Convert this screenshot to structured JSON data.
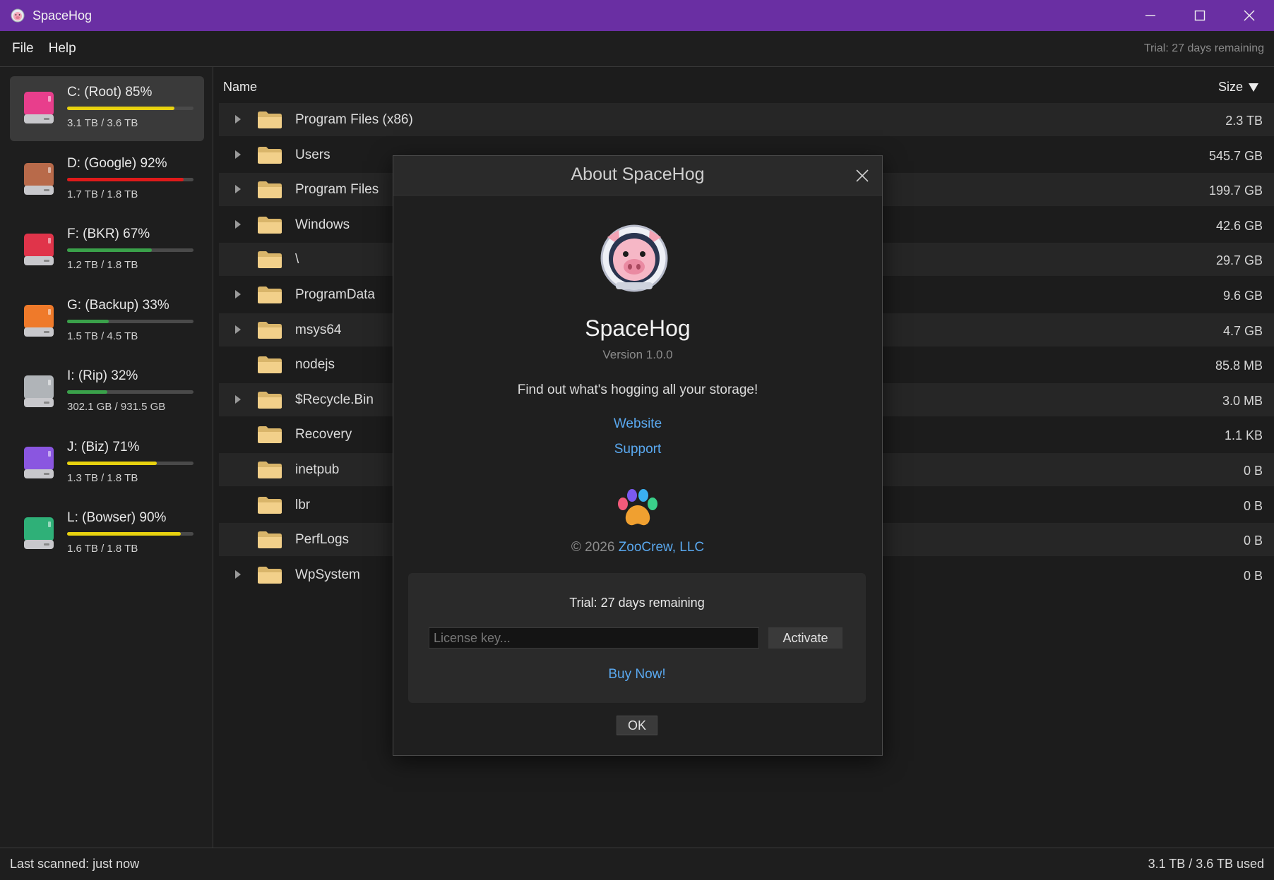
{
  "window": {
    "title": "SpaceHog"
  },
  "menu": {
    "file": "File",
    "help": "Help",
    "trial_status": "Trial: 27 days remaining"
  },
  "drives": [
    {
      "name": "C: (Root) 85%",
      "size": "3.1 TB / 3.6 TB",
      "usage": 0.85,
      "bar_color": "#e8d20f",
      "icon_color": "#e83e8c",
      "selected": true
    },
    {
      "name": "D: (Google) 92%",
      "size": "1.7 TB / 1.8 TB",
      "usage": 0.92,
      "bar_color": "#e01a1a",
      "icon_color": "#b86a4a",
      "selected": false
    },
    {
      "name": "F: (BKR) 67%",
      "size": "1.2 TB / 1.8 TB",
      "usage": 0.67,
      "bar_color": "#3aa14a",
      "icon_color": "#e0344a",
      "selected": false
    },
    {
      "name": "G: (Backup) 33%",
      "size": "1.5 TB / 4.5 TB",
      "usage": 0.33,
      "bar_color": "#3aa14a",
      "icon_color": "#ef7a2a",
      "selected": false
    },
    {
      "name": "I: (Rip) 32%",
      "size": "302.1 GB / 931.5 GB",
      "usage": 0.32,
      "bar_color": "#3aa14a",
      "icon_color": "#b0b4b8",
      "selected": false
    },
    {
      "name": "J: (Biz) 71%",
      "size": "1.3 TB / 1.8 TB",
      "usage": 0.71,
      "bar_color": "#e8d20f",
      "icon_color": "#8a56e0",
      "selected": false
    },
    {
      "name": "L: (Bowser) 90%",
      "size": "1.6 TB / 1.8 TB",
      "usage": 0.9,
      "bar_color": "#e8d20f",
      "icon_color": "#2fb078",
      "selected": false
    }
  ],
  "list": {
    "header_name": "Name",
    "header_size": "Size",
    "rows": [
      {
        "name": "Program Files (x86)",
        "size": "2.3 TB",
        "expandable": true
      },
      {
        "name": "Users",
        "size": "545.7 GB",
        "expandable": true
      },
      {
        "name": "Program Files",
        "size": "199.7 GB",
        "expandable": true
      },
      {
        "name": "Windows",
        "size": "42.6 GB",
        "expandable": true
      },
      {
        "name": "\\",
        "size": "29.7 GB",
        "expandable": false
      },
      {
        "name": "ProgramData",
        "size": "9.6 GB",
        "expandable": true
      },
      {
        "name": "msys64",
        "size": "4.7 GB",
        "expandable": true
      },
      {
        "name": "nodejs",
        "size": "85.8 MB",
        "expandable": false
      },
      {
        "name": "$Recycle.Bin",
        "size": "3.0 MB",
        "expandable": true
      },
      {
        "name": "Recovery",
        "size": "1.1 KB",
        "expandable": false
      },
      {
        "name": "inetpub",
        "size": "0 B",
        "expandable": false
      },
      {
        "name": "lbr",
        "size": "0 B",
        "expandable": false
      },
      {
        "name": "PerfLogs",
        "size": "0 B",
        "expandable": false
      },
      {
        "name": "WpSystem",
        "size": "0 B",
        "expandable": true
      }
    ]
  },
  "status": {
    "left": "Last scanned: just now",
    "right": "3.1 TB / 3.6 TB used"
  },
  "about": {
    "title": "About SpaceHog",
    "app_name": "SpaceHog",
    "version": "Version 1.0.0",
    "tagline": "Find out what's hogging all your storage!",
    "website": "Website",
    "support": "Support",
    "copyright_prefix": "© 2026",
    "company": "ZooCrew, LLC",
    "trial": "Trial: 27 days remaining",
    "license_placeholder": "License key...",
    "activate": "Activate",
    "buy_now": "Buy Now!",
    "ok": "OK"
  }
}
